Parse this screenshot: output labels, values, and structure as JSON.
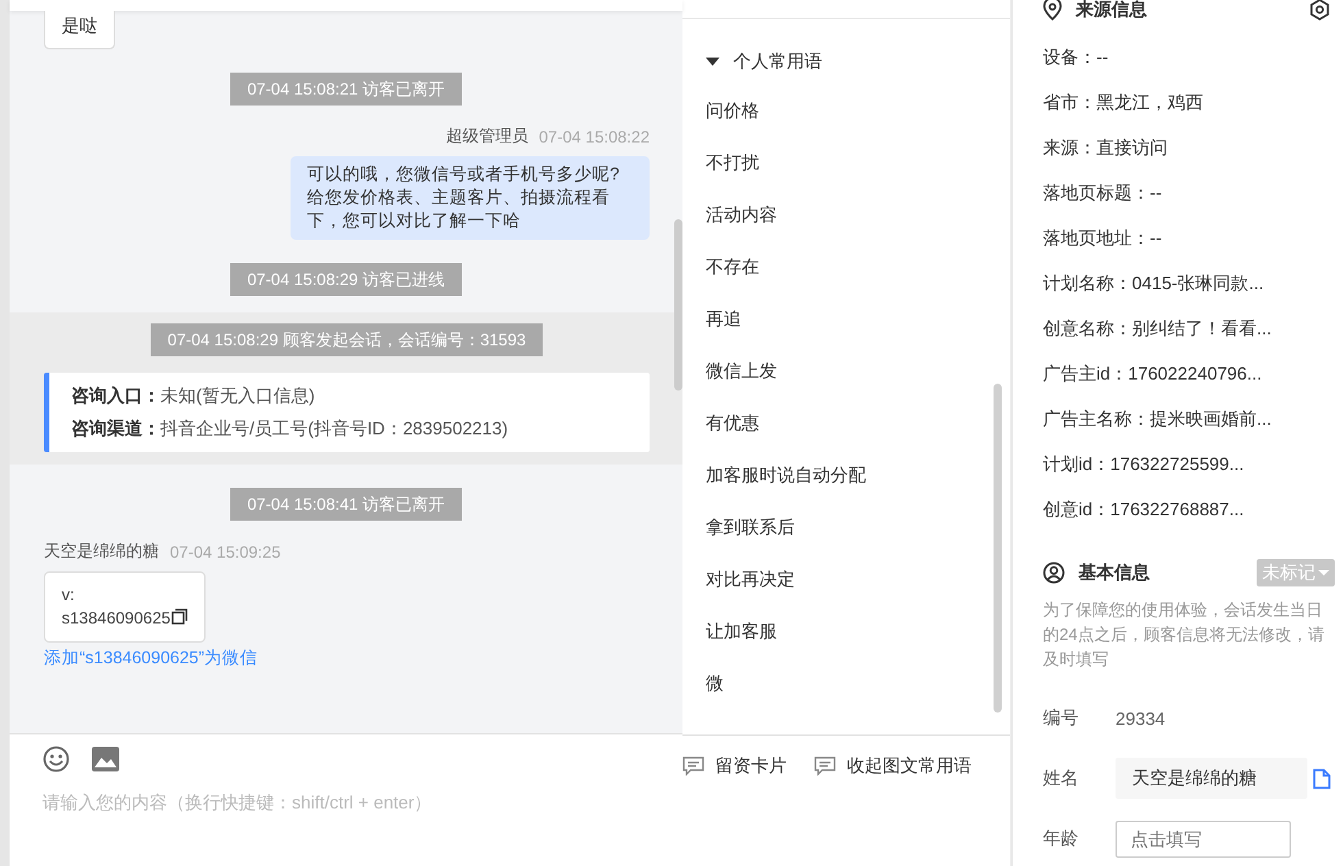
{
  "chat": {
    "messages": [
      {
        "kind": "visitor_bubble",
        "text": "是哒"
      },
      {
        "kind": "system",
        "text": "07-04 15:08:21 访客已离开"
      },
      {
        "kind": "agent",
        "sender": "超级管理员",
        "time": "07-04 15:08:22",
        "text": "可以的哦，您微信号或者手机号多少呢?给您发价格表、主题客片、拍摄流程看下，您可以对比了解一下哈"
      },
      {
        "kind": "system",
        "text": "07-04 15:08:29 访客已进线"
      },
      {
        "kind": "session",
        "text": "07-04 15:08:29 顾客发起会话，会话编号：31593",
        "entries": [
          {
            "label": "咨询入口：",
            "value": "未知(暂无入口信息)"
          },
          {
            "label": "咨询渠道：",
            "value": "抖音企业号/员工号(抖音号ID：2839502213)"
          }
        ]
      },
      {
        "kind": "system",
        "text": "07-04 15:08:41 访客已离开"
      },
      {
        "kind": "visitor_card",
        "sender": "天空是绵绵的糖",
        "time": "07-04 15:09:25",
        "lines": [
          "v:",
          "s13846090625"
        ],
        "link": "添加“s13846090625”为微信"
      }
    ],
    "input": {
      "placeholder": "请输入您的内容（换行快捷键：shift/ctrl + enter）"
    }
  },
  "phrases": {
    "group": {
      "label": "个人常用语",
      "expanded": true
    },
    "items": [
      "问价格",
      "不打扰",
      "活动内容",
      "不存在",
      "再追",
      "微信上发",
      "有优惠",
      "加客服时说自动分配",
      "拿到联系后",
      "对比再决定",
      "让加客服",
      "微"
    ],
    "actions": [
      "留资卡片",
      "收起图文常用语"
    ]
  },
  "source": {
    "title": "来源信息",
    "rows": [
      "设备：--",
      "省市：黑龙江，鸡西",
      "来源：直接访问",
      "落地页标题：--",
      "落地页地址：--",
      "计划名称：0415-张琳同款...",
      "创意名称：别纠结了！看看...",
      "广告主id：176022240796...",
      "广告主名称：提米映画婚前...",
      "计划id：176322725599...",
      "创意id：176322768887..."
    ]
  },
  "basic": {
    "title": "基本信息",
    "tag": "未标记",
    "notice": "为了保障您的使用体验，会话发生当日的24点之后，顾客信息将无法修改，请及时填写",
    "fields": [
      {
        "kind": "text",
        "label": "编号",
        "value": "29334"
      },
      {
        "kind": "input",
        "label": "姓名",
        "value": "天空是绵绵的糖"
      },
      {
        "kind": "empty",
        "label": "年龄",
        "placeholder": "点击填写"
      }
    ]
  }
}
